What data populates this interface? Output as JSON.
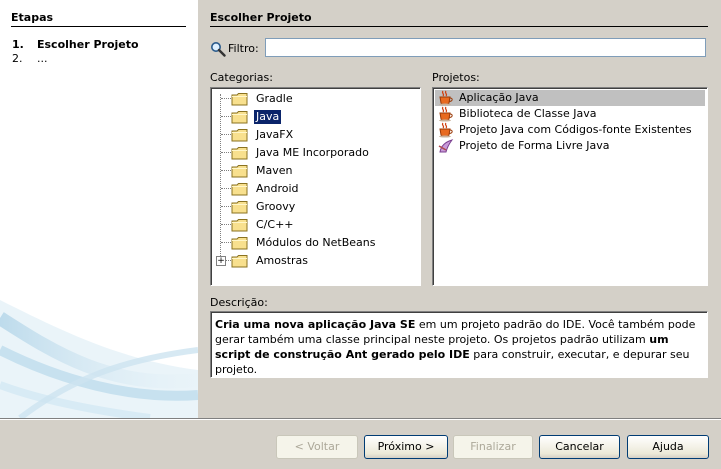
{
  "steps": {
    "title": "Etapas",
    "items": [
      {
        "number": "1.",
        "label": "Escolher Projeto"
      },
      {
        "number": "2.",
        "label": "..."
      }
    ]
  },
  "panel": {
    "title": "Escolher Projeto",
    "filter_label": "Filtro:",
    "filter_value": "",
    "categories_label": "Categorias:",
    "projects_label": "Projetos:",
    "description_label": "Descrição:"
  },
  "categories": [
    {
      "label": "Gradle"
    },
    {
      "label": "Java",
      "selected": true
    },
    {
      "label": "JavaFX"
    },
    {
      "label": "Java ME Incorporado"
    },
    {
      "label": "Maven"
    },
    {
      "label": "Android"
    },
    {
      "label": "Groovy"
    },
    {
      "label": "C/C++"
    },
    {
      "label": "Módulos do NetBeans"
    },
    {
      "label": "Amostras",
      "expander": "+"
    }
  ],
  "projects": [
    {
      "label": "Aplicação Java",
      "icon": "java-cup-icon",
      "selected": true
    },
    {
      "label": "Biblioteca de Classe Java",
      "icon": "java-cup-icon"
    },
    {
      "label": "Projeto Java com Códigos-fonte Existentes",
      "icon": "java-cup-icon"
    },
    {
      "label": "Projeto de Forma Livre Java",
      "icon": "freeform-project-icon"
    }
  ],
  "description": {
    "part1": "Cria uma nova aplicação Java SE",
    "part2": " em um projeto padrão do IDE. Você também pode gerar também uma classe principal neste projeto. Os projetos padrão utilizam ",
    "part3": "um script de construção Ant gerado pelo IDE",
    "part4": " para construir, executar, e depurar seu projeto."
  },
  "buttons": {
    "back": "< Voltar",
    "next": "Próximo >",
    "finish": "Finalizar",
    "cancel": "Cancelar",
    "help": "Ajuda"
  },
  "colors": {
    "selection": "#0a246a",
    "dialog_bg": "#d4d0c8",
    "folder": "#f8e08e"
  }
}
